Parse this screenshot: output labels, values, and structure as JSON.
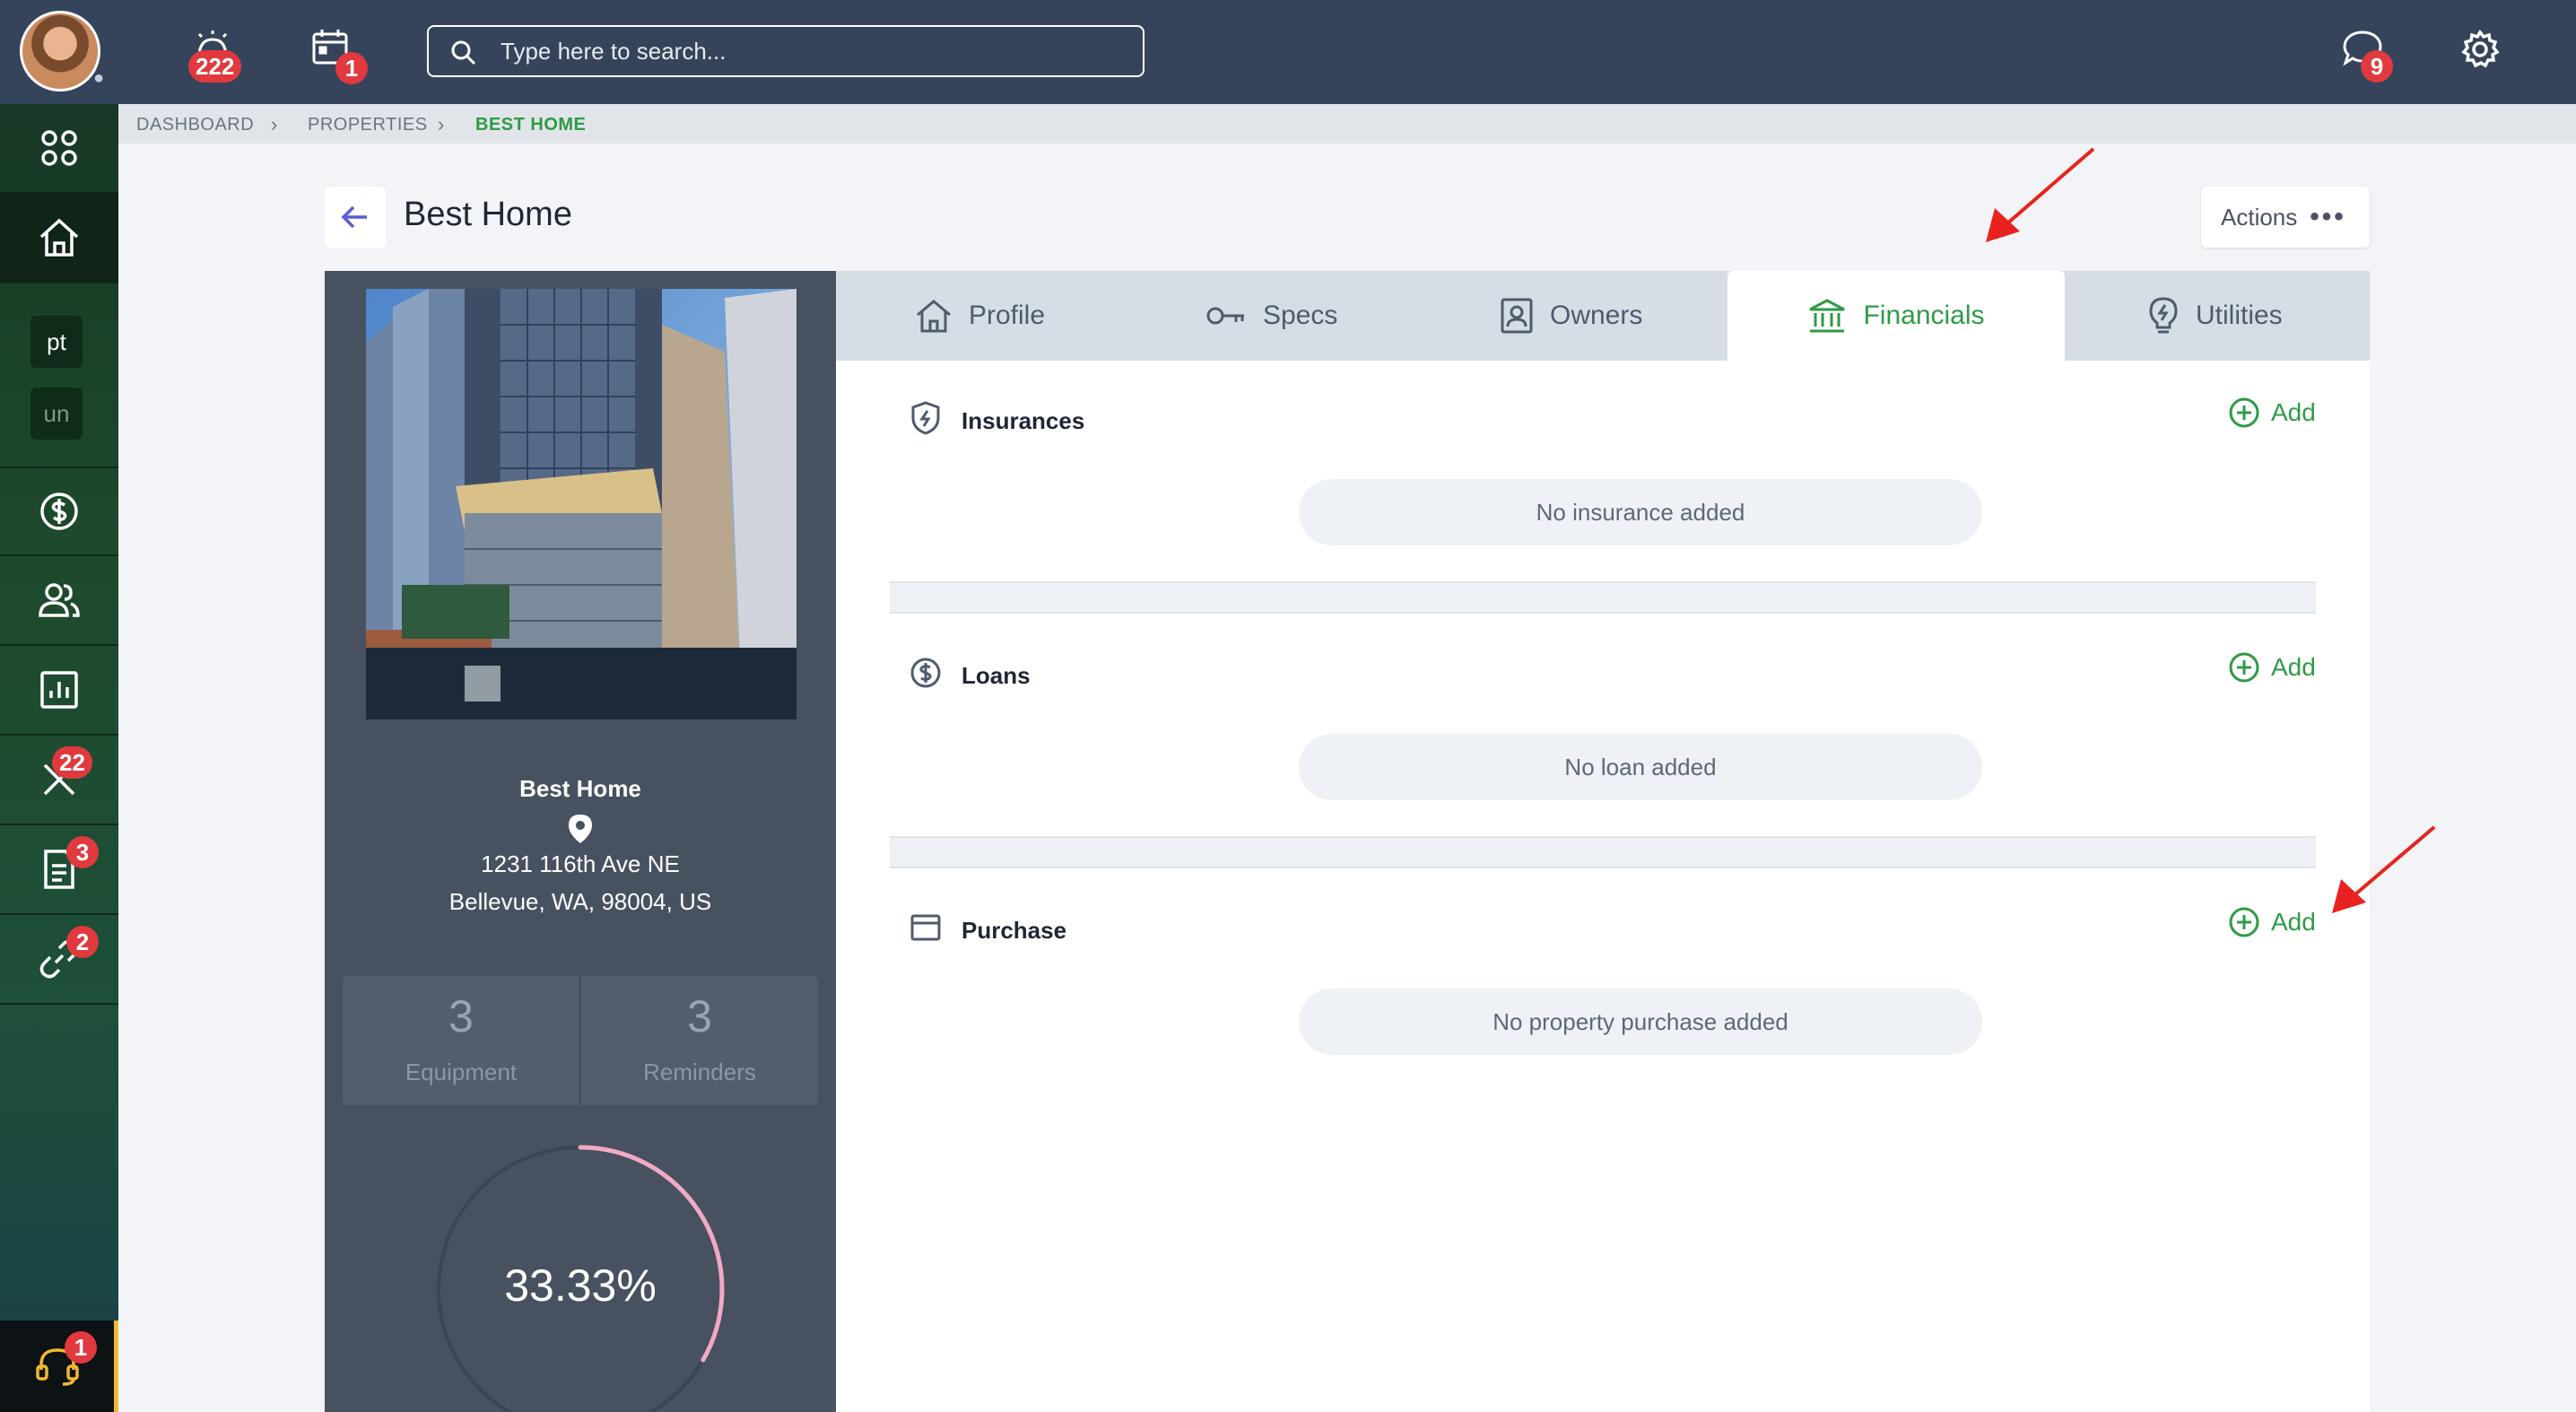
{
  "topbar": {
    "alerts_count": "222",
    "calendar_count": "1",
    "chat_count": "9",
    "search_placeholder": "Type here to search..."
  },
  "sidebar": {
    "workspaces": [
      "pt",
      "un"
    ],
    "badges": {
      "tools": "22",
      "documents": "3",
      "links": "2",
      "support": "1"
    }
  },
  "breadcrumb": [
    "DASHBOARD",
    "PROPERTIES",
    "BEST HOME"
  ],
  "page": {
    "title": "Best Home",
    "actions_label": "Actions"
  },
  "property": {
    "name": "Best Home",
    "address_line1": "1231 116th Ave NE",
    "address_line2": "Bellevue, WA, 98004, US",
    "equipment_count": "3",
    "equipment_label": "Equipment",
    "reminders_count": "3",
    "reminders_label": "Reminders",
    "completion_text": "33.33%",
    "completion_fraction": 0.3333
  },
  "tabs": [
    {
      "label": "Profile",
      "icon": "house-icon"
    },
    {
      "label": "Specs",
      "icon": "key-icon"
    },
    {
      "label": "Owners",
      "icon": "person-card-icon"
    },
    {
      "label": "Financials",
      "icon": "bank-icon",
      "active": true
    },
    {
      "label": "Utilities",
      "icon": "lightbulb-icon"
    }
  ],
  "sections": [
    {
      "title": "Insurances",
      "icon": "shield-icon",
      "add_label": "Add",
      "empty_text": "No insurance added"
    },
    {
      "title": "Loans",
      "icon": "dollar-circle-icon",
      "add_label": "Add",
      "empty_text": "No loan added"
    },
    {
      "title": "Purchase",
      "icon": "credit-card-icon",
      "add_label": "Add",
      "empty_text": "No property purchase added"
    }
  ],
  "colors": {
    "accent": "#2f9a45",
    "topbar": "#36445b",
    "badge": "#e0393e",
    "arrow": "#e8231f",
    "ring": "#f2a9c3"
  }
}
